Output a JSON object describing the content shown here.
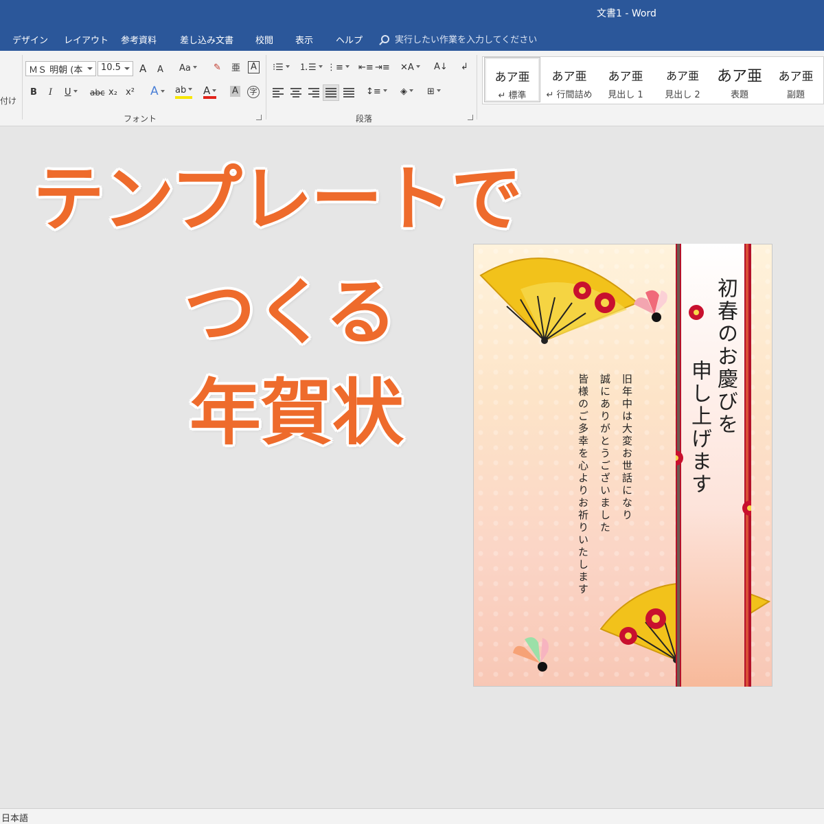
{
  "window": {
    "title": "文書1  -  Word"
  },
  "tabs": [
    "デザイン",
    "レイアウト",
    "参考資料",
    "差し込み文書",
    "校閲",
    "表示",
    "ヘルプ"
  ],
  "tell_me": {
    "placeholder": "実行したい作業を入力してください"
  },
  "ribbon": {
    "clipboard_label_fragment": "付け",
    "font": {
      "name": "ＭＳ 明朝 (本",
      "size": "10.5",
      "grow": "A",
      "shrink": "A",
      "case": "Aa",
      "phonetic": "亜",
      "enclosed": "A",
      "bold": "B",
      "italic": "I",
      "underline": "U",
      "strike": "abc",
      "subscript": "x₂",
      "superscript": "x²",
      "effects": "A",
      "highlight": "ab",
      "font_color": "A",
      "char_shading": "A",
      "enclose_char": "字",
      "group_label": "フォント"
    },
    "paragraph": {
      "group_label": "段落"
    },
    "styles": [
      {
        "sample": "あア亜",
        "name": "↵ 標準",
        "selected": true
      },
      {
        "sample": "あア亜",
        "name": "↵ 行間詰め",
        "selected": false
      },
      {
        "sample": "あア亜",
        "name": "見出し 1",
        "selected": false
      },
      {
        "sample": "あア亜",
        "name": "見出し 2",
        "selected": false
      },
      {
        "sample": "あア亜",
        "name": "表題",
        "selected": false
      },
      {
        "sample": "あア亜",
        "name": "副題",
        "selected": false
      }
    ]
  },
  "headline": {
    "line1": "テンプレートで",
    "line2": "つくる",
    "line3": "年賀状"
  },
  "card": {
    "greeting_col1": "初春のお慶びを",
    "greeting_col2": "申し上げます",
    "msg_col1": "旧年中は大変お世話になり",
    "msg_col2": "誠にありがとうございました",
    "msg_col3": "皆様のご多幸を心よりお祈りいたします"
  },
  "status": {
    "language": "日本語"
  },
  "colors": {
    "word_blue": "#2b579a",
    "headline_orange": "#ee6b2c",
    "ribbon_bg": "#f3f3f3",
    "canvas_bg": "#e6e6e6"
  }
}
